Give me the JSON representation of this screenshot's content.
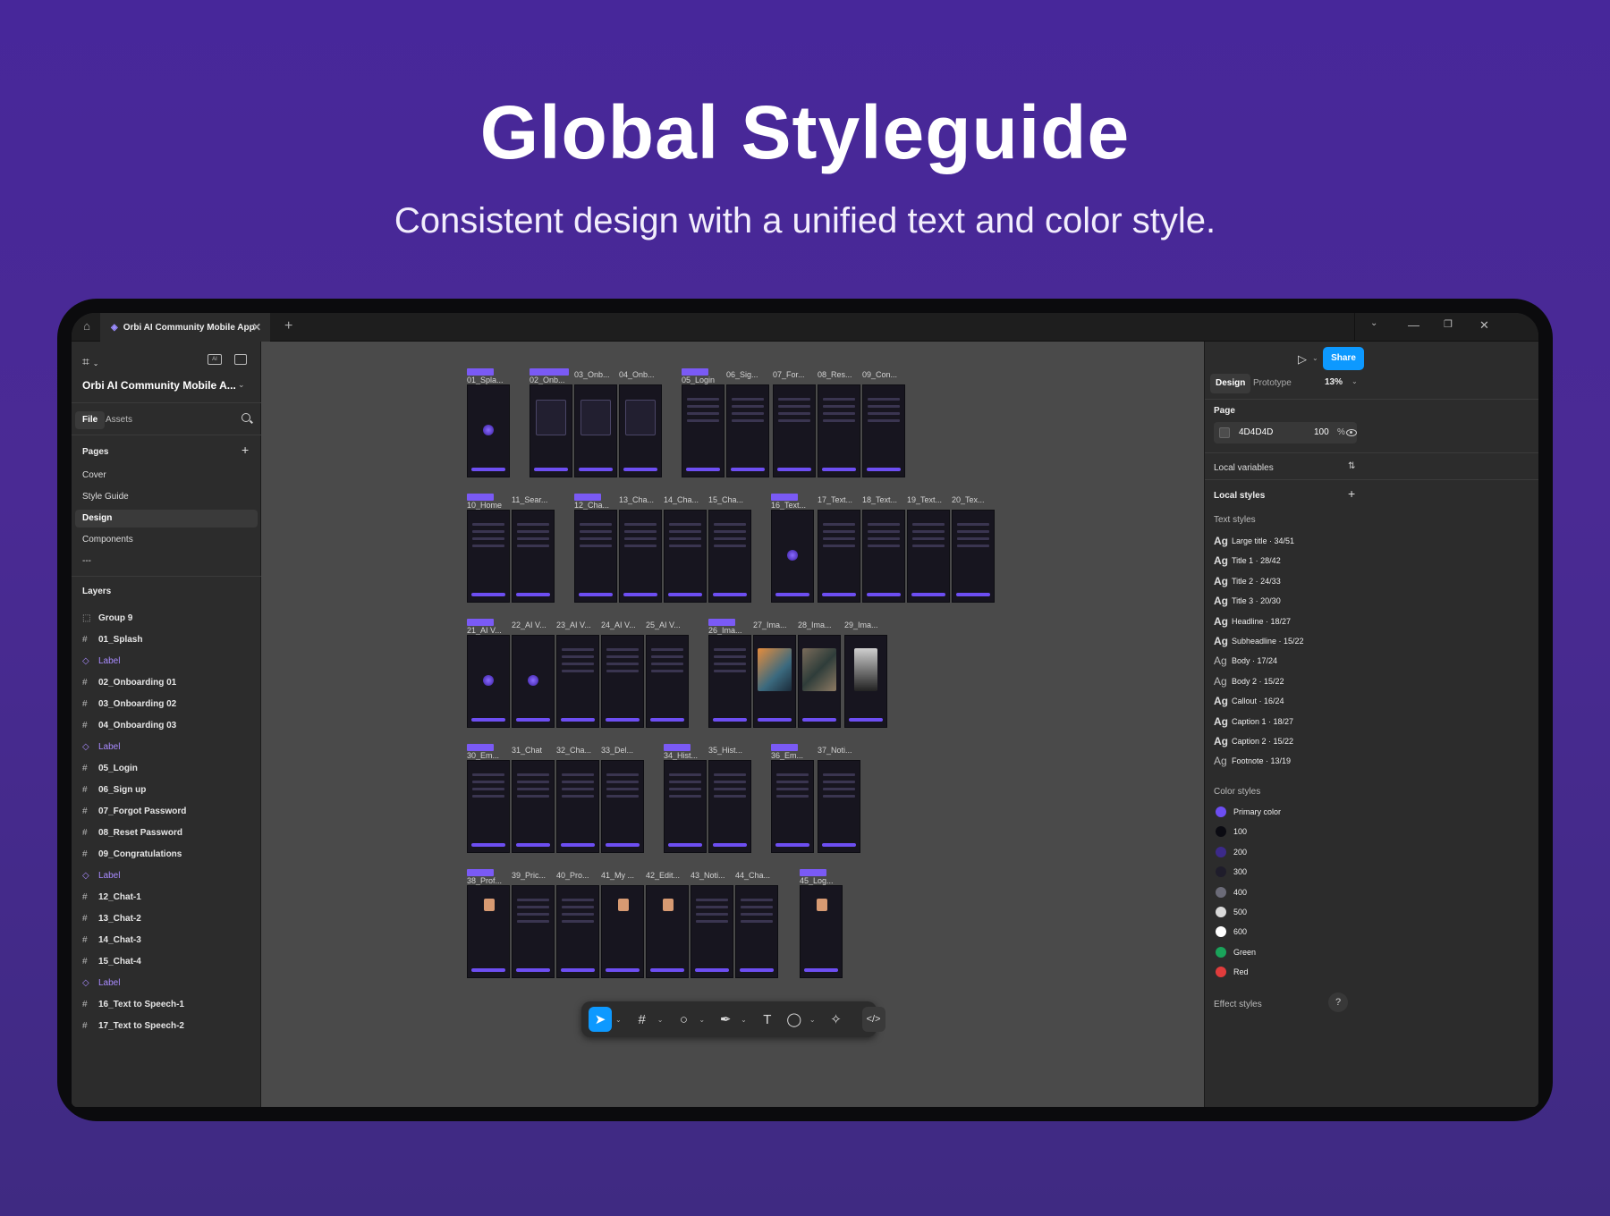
{
  "hero": {
    "title": "Global Styleguide",
    "subtitle": "Consistent design with a unified text and color style."
  },
  "window": {
    "tab_title": "Orbi AI Community Mobile App",
    "file_icon": "figma-file-icon",
    "home_icon": "home-icon"
  },
  "left_panel": {
    "project_name": "Orbi AI Community Mobile A...",
    "tabs": [
      "File",
      "Assets"
    ],
    "pages_heading": "Pages",
    "pages": [
      "Cover",
      "Style Guide",
      "Design",
      "Components",
      "---"
    ],
    "active_page": "Design",
    "layers_heading": "Layers",
    "layers": [
      {
        "name": "Group 9",
        "type": "group"
      },
      {
        "name": "01_Splash",
        "type": "frame"
      },
      {
        "name": "Label",
        "type": "component"
      },
      {
        "name": "02_Onboarding 01",
        "type": "frame"
      },
      {
        "name": "03_Onboarding 02",
        "type": "frame"
      },
      {
        "name": "04_Onboarding 03",
        "type": "frame"
      },
      {
        "name": "Label",
        "type": "component"
      },
      {
        "name": "05_Login",
        "type": "frame"
      },
      {
        "name": "06_Sign up",
        "type": "frame"
      },
      {
        "name": "07_Forgot Password",
        "type": "frame"
      },
      {
        "name": "08_Reset Password",
        "type": "frame"
      },
      {
        "name": "09_Congratulations",
        "type": "frame"
      },
      {
        "name": "Label",
        "type": "component"
      },
      {
        "name": "12_Chat-1",
        "type": "frame"
      },
      {
        "name": "13_Chat-2",
        "type": "frame"
      },
      {
        "name": "14_Chat-3",
        "type": "frame"
      },
      {
        "name": "15_Chat-4",
        "type": "frame"
      },
      {
        "name": "Label",
        "type": "component"
      },
      {
        "name": "16_Text to Speech-1",
        "type": "frame"
      },
      {
        "name": "17_Text to Speech-2",
        "type": "frame"
      }
    ]
  },
  "canvas": {
    "rows": [
      [
        "01_Spla...",
        "02_Onb...",
        "03_Onb...",
        "04_Onb...",
        "05_Login",
        "06_Sig...",
        "07_For...",
        "08_Res...",
        "09_Con..."
      ],
      [
        "10_Home",
        "11_Sear...",
        "12_Cha...",
        "13_Cha...",
        "14_Cha...",
        "15_Cha...",
        "16_Text...",
        "17_Text...",
        "18_Text...",
        "19_Text...",
        "20_Tex..."
      ],
      [
        "21_AI V...",
        "22_AI V...",
        "23_AI V...",
        "24_AI V...",
        "25_AI V...",
        "26_Ima...",
        "27_Ima...",
        "28_Ima...",
        "29_Ima..."
      ],
      [
        "30_Em...",
        "31_Chat",
        "32_Cha...",
        "33_Del...",
        "34_Hist...",
        "35_Hist...",
        "36_Em...",
        "37_Noti..."
      ],
      [
        "38_Prof...",
        "39_Pric...",
        "40_Pro...",
        "41_My ...",
        "42_Edit...",
        "43_Noti...",
        "44_Cha...",
        "45_Log..."
      ]
    ]
  },
  "toolbar": {
    "tools": [
      "move-icon",
      "frame-icon",
      "ellipse-icon",
      "pen-icon",
      "text-icon",
      "comment-icon",
      "ai-icon",
      "dev-mode-icon"
    ],
    "text_tool_label": "T",
    "dev_label": "</>"
  },
  "right_panel": {
    "share_label": "Share",
    "tabs": [
      "Design",
      "Prototype"
    ],
    "zoom": "13%",
    "page_heading": "Page",
    "page_color": "4D4D4D",
    "page_opacity": "100",
    "percent_sign": "%",
    "local_variables": "Local variables",
    "local_styles": "Local styles",
    "text_styles_heading": "Text styles",
    "text_styles": [
      {
        "ag": "Ag",
        "name": "Large title · 34/51",
        "bold": true
      },
      {
        "ag": "Ag",
        "name": "Title 1 · 28/42",
        "bold": true
      },
      {
        "ag": "Ag",
        "name": "Title 2 · 24/33",
        "bold": true
      },
      {
        "ag": "Ag",
        "name": "Title 3 · 20/30",
        "bold": true
      },
      {
        "ag": "Ag",
        "name": "Headline · 18/27",
        "bold": true
      },
      {
        "ag": "Ag",
        "name": "Subheadline · 15/22",
        "bold": true
      },
      {
        "ag": "Ag",
        "name": "Body · 17/24",
        "bold": false
      },
      {
        "ag": "Ag",
        "name": "Body 2 · 15/22",
        "bold": false
      },
      {
        "ag": "Ag",
        "name": "Callout · 16/24",
        "bold": true
      },
      {
        "ag": "Ag",
        "name": "Caption 1 · 18/27",
        "bold": true
      },
      {
        "ag": "Ag",
        "name": "Caption 2 · 15/22",
        "bold": true
      },
      {
        "ag": "Ag",
        "name": "Footnote · 13/19",
        "bold": false
      }
    ],
    "color_styles_heading": "Color styles",
    "color_styles": [
      {
        "name": "Primary color",
        "color": "#6d4ef2"
      },
      {
        "name": "100",
        "color": "#0b0b12"
      },
      {
        "name": "200",
        "color": "#3c2a8a"
      },
      {
        "name": "300",
        "color": "#1f1d2b"
      },
      {
        "name": "400",
        "color": "#6b6b78"
      },
      {
        "name": "500",
        "color": "#d9d9d9"
      },
      {
        "name": "600",
        "color": "#ffffff"
      },
      {
        "name": "Green",
        "color": "#1aa35a"
      },
      {
        "name": "Red",
        "color": "#e03c3c"
      }
    ],
    "effect_styles_heading": "Effect styles",
    "help_label": "?"
  },
  "colors": {
    "accent": "#0d99ff",
    "brand": "#6d4ef2",
    "canvas_bg": "#4D4D4D"
  }
}
